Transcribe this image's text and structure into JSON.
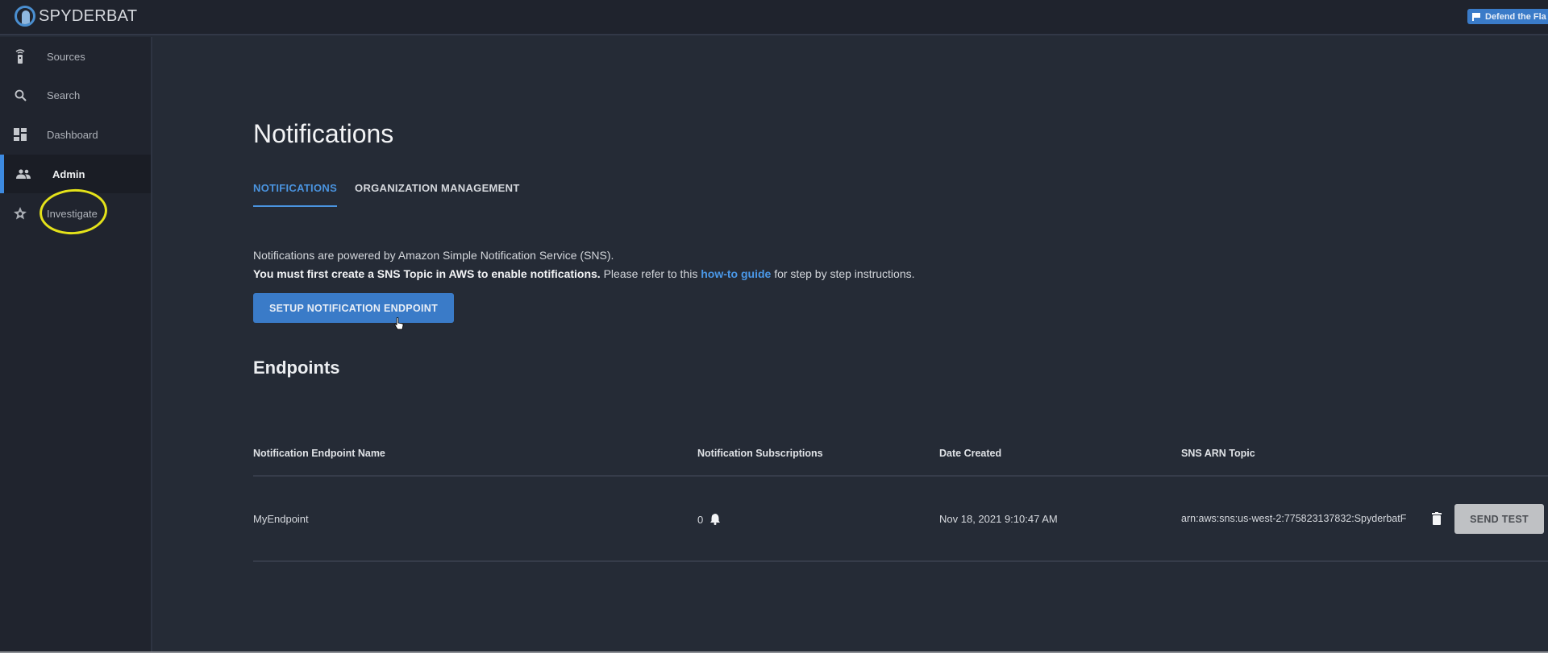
{
  "app": {
    "name": "SPYDERBAT",
    "flag_button_label": "Defend the Fla"
  },
  "sidebar": {
    "items": [
      {
        "label": "Sources",
        "icon": "sources-icon",
        "active": false
      },
      {
        "label": "Search",
        "icon": "search-icon",
        "active": false
      },
      {
        "label": "Dashboard",
        "icon": "dashboard-icon",
        "active": false
      },
      {
        "label": "Admin",
        "icon": "admin-icon",
        "active": true
      },
      {
        "label": "Investigate",
        "icon": "investigate-icon",
        "active": false
      }
    ]
  },
  "page": {
    "title": "Notifications",
    "tabs": [
      {
        "label": "NOTIFICATIONS",
        "active": true
      },
      {
        "label": "ORGANIZATION MANAGEMENT",
        "active": false
      }
    ],
    "info_line1": "Notifications are powered by Amazon Simple Notification Service (SNS).",
    "info_line2_bold": "You must first create a SNS Topic in AWS to enable notifications.",
    "info_line2_pre": " Please refer to this ",
    "info_link": "how-to guide",
    "info_line2_post": " for step by step instructions.",
    "setup_button": "SETUP NOTIFICATION ENDPOINT"
  },
  "endpoints": {
    "title": "Endpoints",
    "columns": [
      "Notification Endpoint Name",
      "Notification Subscriptions",
      "Date Created",
      "SNS ARN Topic"
    ],
    "rows": [
      {
        "name": "MyEndpoint",
        "subscriptions": "0",
        "date_created": "Nov 18, 2021 9:10:47 AM",
        "sns_arn": "arn:aws:sns:us-west-2:775823137832:SpyderbatF",
        "action_label": "SEND TEST"
      }
    ]
  },
  "colors": {
    "accent": "#3a7bc8",
    "link": "#4a98e8",
    "highlight": "#e4e21a"
  }
}
